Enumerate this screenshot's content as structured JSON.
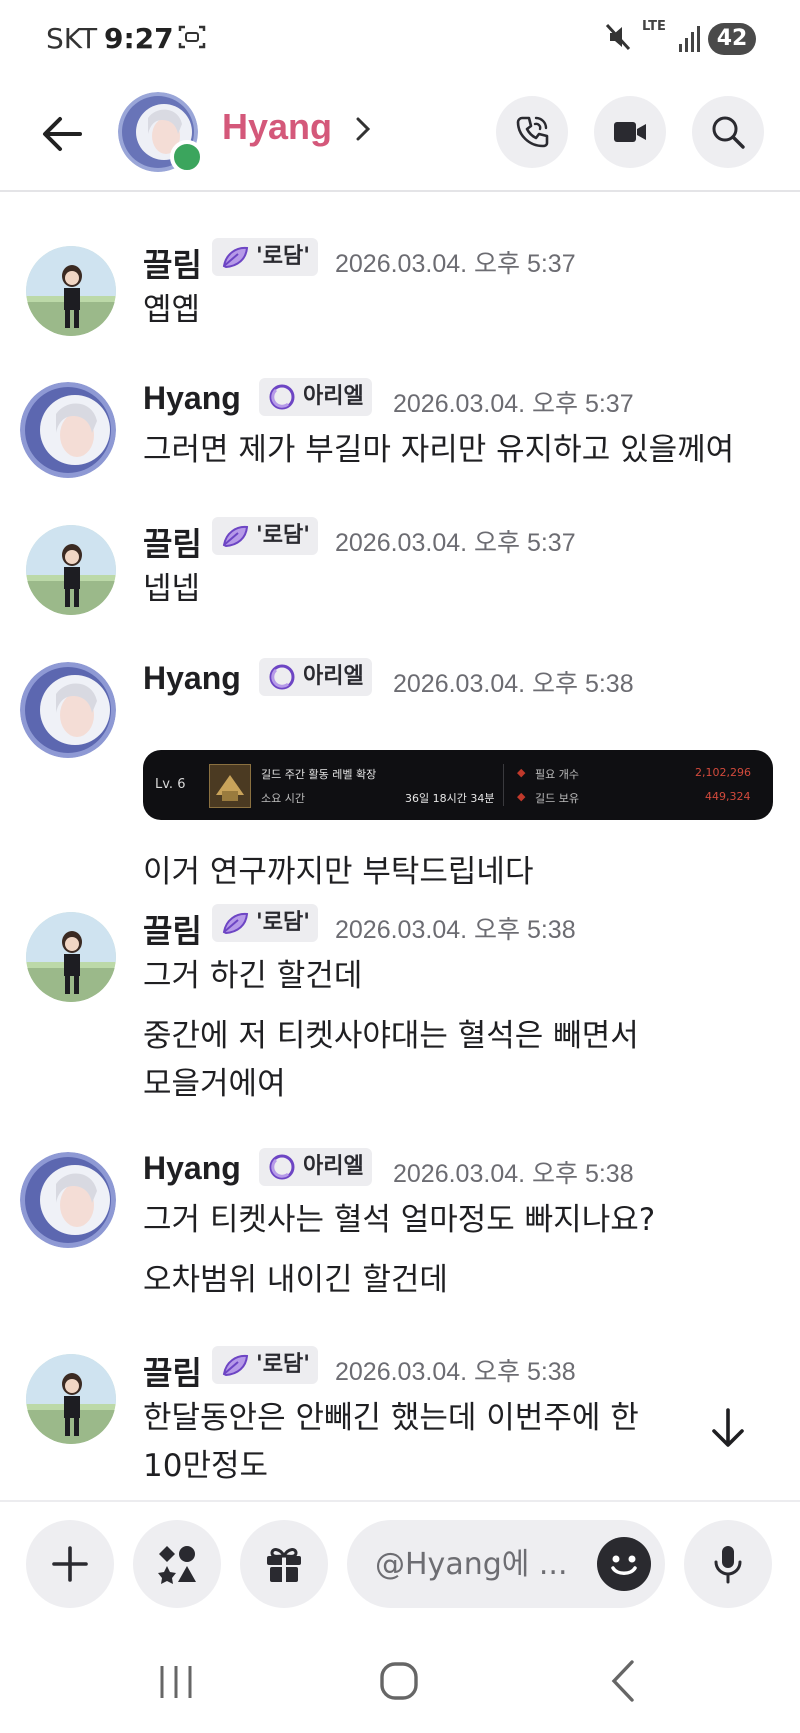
{
  "status_bar": {
    "carrier": "SKT",
    "time": "9:27",
    "network": "LTE",
    "battery": "42"
  },
  "header": {
    "name": "Hyang",
    "online": true,
    "icons": [
      "back-arrow",
      "phone",
      "video-camera",
      "search"
    ]
  },
  "messages": [
    {
      "author": "끌림",
      "server_tag": "'로담'",
      "timestamp": "2026.03.04. 오후 5:37",
      "lines": [
        "옙옙"
      ]
    },
    {
      "author": "Hyang",
      "server_tag": "아리엘",
      "timestamp": "2026.03.04. 오후 5:37",
      "lines": [
        "그러면 제가 부길마 자리만 유지하고 있을께여"
      ]
    },
    {
      "author": "끌림",
      "server_tag": "'로담'",
      "timestamp": "2026.03.04. 오후 5:37",
      "lines": [
        "넵넵"
      ]
    },
    {
      "author": "Hyang",
      "server_tag": "아리엘",
      "timestamp": "2026.03.04. 오후 5:38",
      "attachment": {
        "level": "Lv. 6",
        "title": "길드 주간 활동 레벨 확장",
        "time_label": "소요 시간",
        "time_value": "36일 18시간 34분",
        "req_label": "필요 개수",
        "req_value": "2,102,296",
        "own_label": "길드 보유",
        "own_value": "449,324"
      },
      "lines": [
        "이거 연구까지만 부탁드립네다"
      ]
    },
    {
      "author": "끌림",
      "server_tag": "'로담'",
      "timestamp": "2026.03.04. 오후 5:38",
      "lines": [
        "그거 하긴 할건데",
        "중간에 저 티켓사야대는 혈석은 빼면서",
        "모을거에여"
      ]
    },
    {
      "author": "Hyang",
      "server_tag": "아리엘",
      "timestamp": "2026.03.04. 오후 5:38",
      "lines": [
        "그거 티켓사는 혈석 얼마정도 빠지나요?",
        "오차범위 내이긴 할건데"
      ]
    },
    {
      "author": "끌림",
      "server_tag": "'로담'",
      "timestamp": "2026.03.04. 오후 5:38",
      "lines": [
        "한달동안은 안빼긴 했는데 이번주에 한",
        "10만정도"
      ]
    }
  ],
  "composer": {
    "placeholder": "@Hyang에 ...",
    "icons": [
      "plus",
      "apps",
      "gift",
      "emoji",
      "microphone"
    ]
  },
  "colors": {
    "header_name": "#d4587a",
    "online": "#3ba55d",
    "tag_bg": "#ededf0",
    "tag_icon_purple": "#9b6ddb"
  }
}
